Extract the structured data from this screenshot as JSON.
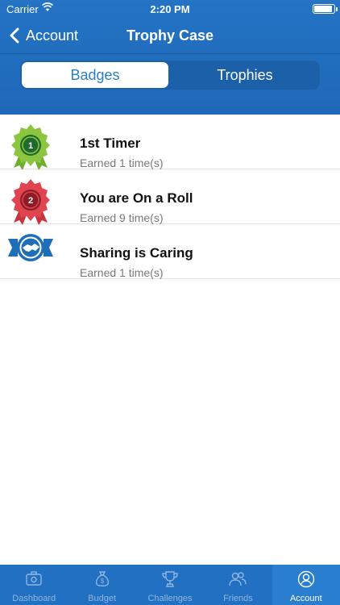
{
  "status_bar": {
    "carrier": "Carrier",
    "time": "2:20 PM"
  },
  "nav": {
    "back_label": "Account",
    "title": "Trophy Case"
  },
  "segments": [
    {
      "label": "Badges",
      "selected": true
    },
    {
      "label": "Trophies",
      "selected": false
    }
  ],
  "badges": [
    {
      "number": "1",
      "title": "1st Timer",
      "subtitle": "Earned 1 time(s)",
      "color": "#8cc63f"
    },
    {
      "number": "2",
      "title": "You are On a Roll",
      "subtitle": "Earned 9 time(s)",
      "color": "#e0454f"
    },
    {
      "number": "",
      "title": "Sharing is Caring",
      "subtitle": "Earned 1 time(s)",
      "color": "#1e6fb8"
    }
  ],
  "tabs": [
    {
      "label": "Dashboard",
      "icon": "dashboard-icon",
      "active": false
    },
    {
      "label": "Budget",
      "icon": "money-bag-icon",
      "active": false
    },
    {
      "label": "Challenges",
      "icon": "trophy-icon",
      "active": false
    },
    {
      "label": "Friends",
      "icon": "friends-icon",
      "active": false
    },
    {
      "label": "Account",
      "icon": "account-icon",
      "active": true
    }
  ],
  "colors": {
    "primary": "#2270c1",
    "accent": "#2a80c9"
  }
}
